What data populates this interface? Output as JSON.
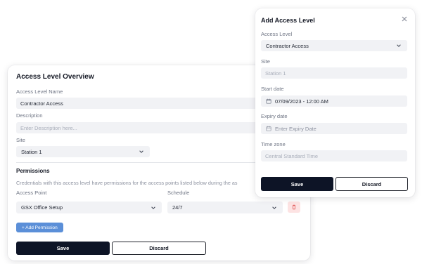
{
  "overview": {
    "title": "Access Level Overview",
    "name_label": "Access Level Name",
    "name_value": "Contractor Access",
    "description_label": "Description",
    "description_placeholder": "Enter Description here...",
    "site_label": "Site",
    "site_value": "Station 1",
    "permissions_title": "Permissions",
    "permissions_text": "Credentials with this access level have permissions for the access points listed below during the as",
    "access_point_label": "Access Point",
    "schedule_label": "Schedule",
    "access_point_value": "GSX Office Setup",
    "schedule_value": "24/7",
    "add_permission": "+ Add Permission",
    "save": "Save",
    "discard": "Discard"
  },
  "modal": {
    "title": "Add Access Level",
    "access_level_label": "Access Level",
    "access_level_value": "Contractor Access",
    "site_label": "Site",
    "site_placeholder": "Station 1",
    "start_date_label": "Start date",
    "start_date_value": "07/09/2023 - 12:00 AM",
    "expiry_date_label": "Expiry date",
    "expiry_date_placeholder": "Enter Expiry Date",
    "time_zone_label": "Time zone",
    "time_zone_placeholder": "Central Standard Time",
    "save": "Save",
    "discard": "Discard"
  },
  "icons": {
    "chevron": "chevron-down-icon",
    "calendar": "calendar-icon",
    "trash": "trash-icon",
    "close": "close-icon"
  },
  "colors": {
    "primary_dark": "#0d1426",
    "accent_blue": "#5b8fd8",
    "danger_bg": "#fde3e3",
    "danger_icon": "#e05656"
  }
}
